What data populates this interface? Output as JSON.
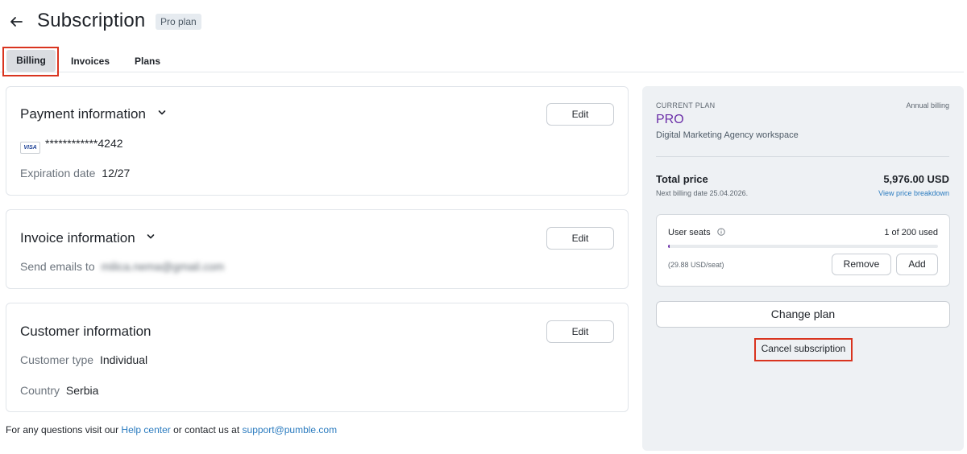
{
  "header": {
    "title": "Subscription",
    "badge": "Pro plan"
  },
  "tabs": [
    {
      "label": "Billing",
      "active": true
    },
    {
      "label": "Invoices",
      "active": false
    },
    {
      "label": "Plans",
      "active": false
    }
  ],
  "payment": {
    "title": "Payment information",
    "edit_label": "Edit",
    "card_brand": "VISA",
    "card_number": "************4242",
    "expiration_label": "Expiration date",
    "expiration_value": "12/27"
  },
  "invoice": {
    "title": "Invoice information",
    "edit_label": "Edit",
    "emails_label": "Send emails to",
    "emails_value": "milica.nema@gmail.com"
  },
  "customer": {
    "title": "Customer information",
    "edit_label": "Edit",
    "type_label": "Customer type",
    "type_value": "Individual",
    "country_label": "Country",
    "country_value": "Serbia"
  },
  "footer": {
    "prefix": "For any questions visit our",
    "help_link": "Help center",
    "middle": "or contact us at",
    "email_link": "support@pumble.com"
  },
  "plan_panel": {
    "current_plan_label": "CURRENT PLAN",
    "billing_mode": "Annual billing",
    "plan_name": "PRO",
    "workspace": "Digital Marketing Agency workspace",
    "total_label": "Total price",
    "total_value": "5,976.00 USD",
    "next_billing": "Next billing date 25.04.2026.",
    "breakdown_link": "View price breakdown",
    "seats": {
      "label": "User seats",
      "used_text": "1 of 200 used",
      "used": 1,
      "total": 200,
      "price_per_seat": "(29.88 USD/seat)",
      "remove_label": "Remove",
      "add_label": "Add"
    },
    "change_plan_label": "Change plan",
    "cancel_label": "Cancel subscription"
  },
  "colors": {
    "accent_purple": "#6b2fa8",
    "link_blue": "#2a7bbf",
    "highlight_red": "#d9341f"
  }
}
